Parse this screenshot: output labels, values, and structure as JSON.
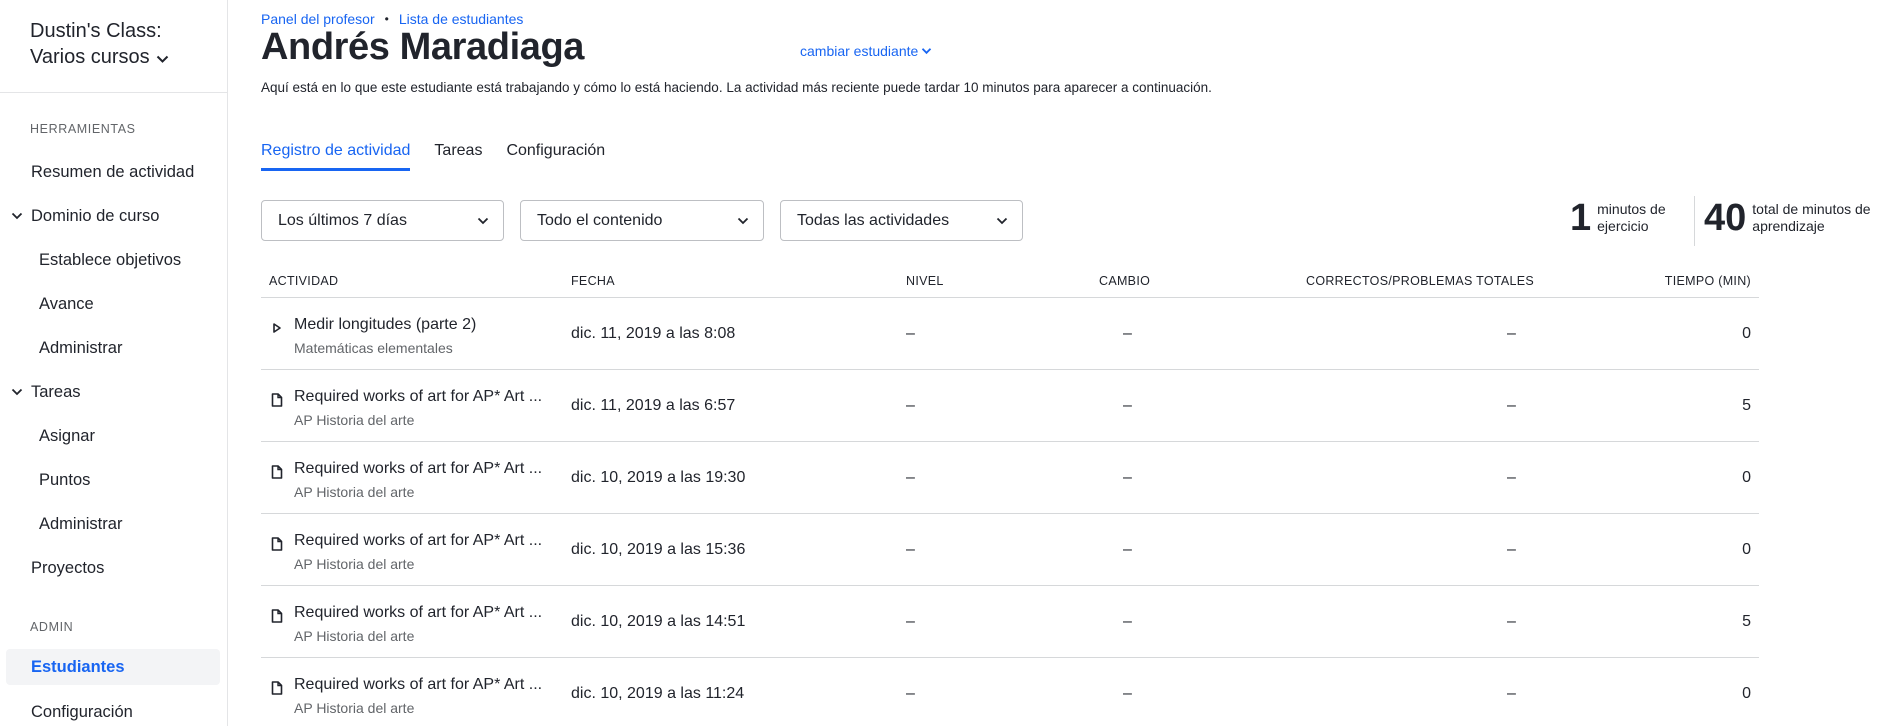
{
  "sidebar": {
    "class_name": "Dustin's Class: Varios cursos",
    "sections": [
      {
        "label": "HERRAMIENTAS"
      },
      {
        "label": "ADMIN"
      }
    ],
    "items": {
      "resumen": "Resumen de actividad",
      "dominio": "Dominio de curso",
      "objetivos": "Establece objetivos",
      "avance": "Avance",
      "administrar1": "Administrar",
      "tareas": "Tareas",
      "asignar": "Asignar",
      "puntos": "Puntos",
      "administrar2": "Administrar",
      "proyectos": "Proyectos",
      "estudiantes": "Estudiantes",
      "configuracion": "Configuración"
    }
  },
  "breadcrumb": [
    "Panel del profesor",
    "Lista de estudiantes"
  ],
  "student": {
    "name": "Andrés Maradiaga",
    "change_label": "cambiar estudiante"
  },
  "description": "Aquí está en lo que este estudiante está trabajando y cómo lo está haciendo. La actividad más reciente puede tardar 10 minutos para aparecer a continuación.",
  "tabs": [
    {
      "label": "Registro de actividad",
      "active": true
    },
    {
      "label": "Tareas",
      "active": false
    },
    {
      "label": "Configuración",
      "active": false
    }
  ],
  "filters": {
    "period": "Los últimos 7 días",
    "content": "Todo el contenido",
    "activities": "Todas las actividades"
  },
  "stats": {
    "exercise_minutes": "1",
    "exercise_label": "minutos de ejercicio",
    "learning_minutes": "40",
    "learning_label": "total de minutos de aprendizaje"
  },
  "table": {
    "headers": {
      "activity": "ACTIVIDAD",
      "date": "FECHA",
      "level": "NIVEL",
      "change": "CAMBIO",
      "correct": "CORRECTOS/PROBLEMAS TOTALES",
      "time": "TIEMPO (MIN)"
    },
    "rows": [
      {
        "icon": "video-play-icon",
        "title": "Medir longitudes (parte 2)",
        "course": "Matemáticas elementales",
        "date": "dic. 11, 2019 a las 8:08",
        "level": "–",
        "change": "–",
        "correct": "–",
        "time": "0"
      },
      {
        "icon": "article-icon",
        "title": "Required works of art for AP* Art ...",
        "course": "AP Historia del arte",
        "date": "dic. 11, 2019 a las 6:57",
        "level": "–",
        "change": "–",
        "correct": "–",
        "time": "5"
      },
      {
        "icon": "article-icon",
        "title": "Required works of art for AP* Art ...",
        "course": "AP Historia del arte",
        "date": "dic. 10, 2019 a las 19:30",
        "level": "–",
        "change": "–",
        "correct": "–",
        "time": "0"
      },
      {
        "icon": "article-icon",
        "title": "Required works of art for AP* Art ...",
        "course": "AP Historia del arte",
        "date": "dic. 10, 2019 a las 15:36",
        "level": "–",
        "change": "–",
        "correct": "–",
        "time": "0"
      },
      {
        "icon": "article-icon",
        "title": "Required works of art for AP* Art ...",
        "course": "AP Historia del arte",
        "date": "dic. 10, 2019 a las 14:51",
        "level": "–",
        "change": "–",
        "correct": "–",
        "time": "5"
      },
      {
        "icon": "article-icon",
        "title": "Required works of art for AP* Art ...",
        "course": "AP Historia del arte",
        "date": "dic. 10, 2019 a las 11:24",
        "level": "–",
        "change": "–",
        "correct": "–",
        "time": "0"
      }
    ]
  },
  "colors": {
    "accent": "#1865f2",
    "text": "#21242c",
    "muted": "#626569",
    "border": "#d6d8da",
    "active_bg": "#f3f4f6"
  }
}
